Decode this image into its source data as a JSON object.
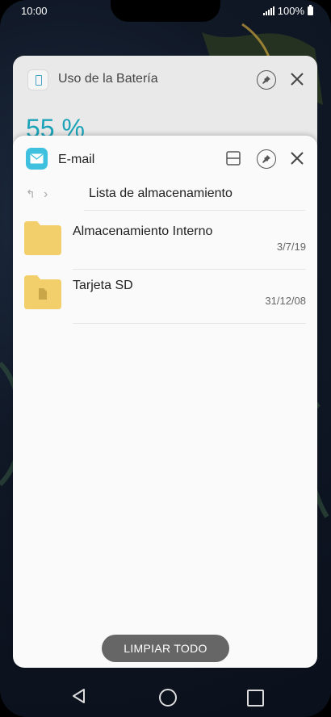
{
  "status_bar": {
    "time": "10:00",
    "battery_text": "100%"
  },
  "back_card": {
    "title": "Uso de la Batería",
    "value": "55 %"
  },
  "front_card": {
    "title": "E-mail",
    "breadcrumb": "Lista de almacenamiento",
    "items": [
      {
        "name": "Almacenamiento Interno",
        "date": "3/7/19"
      },
      {
        "name": "Tarjeta SD",
        "date": "31/12/08"
      }
    ]
  },
  "clear_all_label": "LIMPIAR TODO",
  "colors": {
    "accent": "#1aa3b8",
    "email_icon": "#3ec0de",
    "folder": "#f2cf6b"
  }
}
